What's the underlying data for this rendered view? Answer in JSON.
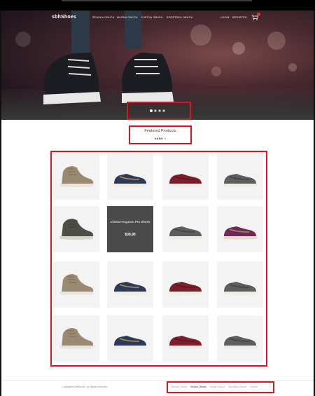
{
  "brand": {
    "logo_text": "sbhShoes"
  },
  "nav": {
    "items": [
      {
        "label": "ŽENSKA OBUĆA"
      },
      {
        "label": "MUŠKA OBUĆA"
      },
      {
        "label": "DJEČJA OBUĆA"
      },
      {
        "label": "SPORTSKA OBUĆA"
      }
    ],
    "login": "LOGIN",
    "register": "REGISTER",
    "cart_icon": "cart-icon"
  },
  "slider": {
    "count": 4,
    "active_index": 0
  },
  "featured": {
    "title": "Featured Products",
    "filter": "VANS ˅"
  },
  "products": [
    {
      "style": "hightop-tan"
    },
    {
      "style": "low-navy"
    },
    {
      "style": "low-maroon"
    },
    {
      "style": "low-grey"
    },
    {
      "style": "hightop-dark"
    },
    {
      "style": "hover",
      "name": "Chima Ferguson Pro Shoes",
      "price": "$39,90"
    },
    {
      "style": "low-grey"
    },
    {
      "style": "low-purple"
    },
    {
      "style": "hightop-tan"
    },
    {
      "style": "low-navy"
    },
    {
      "style": "low-maroon"
    },
    {
      "style": "low-grey"
    },
    {
      "style": "hightop-tan"
    },
    {
      "style": "low-navy"
    },
    {
      "style": "low-maroon"
    },
    {
      "style": "low-grey"
    }
  ],
  "footer": {
    "copyright": "Copyright©sbhShoes. All rights reserved.",
    "links": [
      {
        "label": "Ženska Obuća",
        "active": false
      },
      {
        "label": "Muška Obuća",
        "active": true
      },
      {
        "label": "Dječja Obuća",
        "active": false
      },
      {
        "label": "Sportska Obuća",
        "active": false
      },
      {
        "label": "Onami",
        "active": false
      }
    ]
  },
  "colors": {
    "highlight": "#e0151b",
    "hover_tile": "#4a4a4a"
  }
}
